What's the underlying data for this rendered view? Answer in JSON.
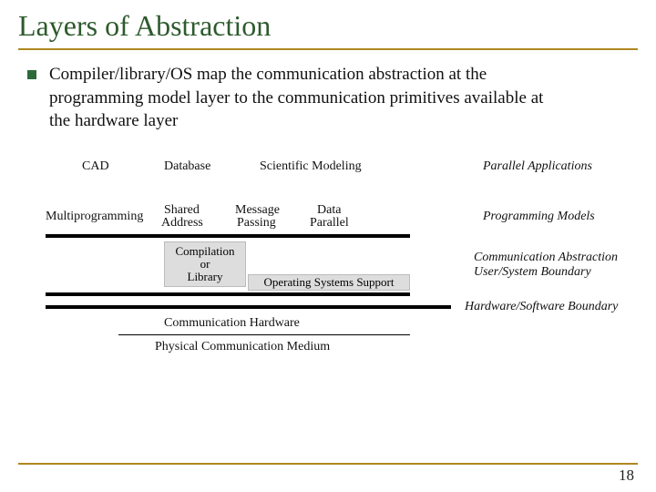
{
  "title": "Layers of Abstraction",
  "bullet": "Compiler/library/OS map the communication abstraction at the programming model layer to the communication primitives available at the hardware layer",
  "side": {
    "apps": "Parallel Applications",
    "models": "Programming Models",
    "comm_abs1": "Communication Abstraction",
    "comm_abs2": "User/System Boundary",
    "hw_sw": "Hardware/Software Boundary"
  },
  "apps": {
    "cad": "CAD",
    "db": "Database",
    "sci": "Scientific Modeling"
  },
  "models": {
    "multi": "Multiprogramming",
    "shared1": "Shared",
    "shared2": "Address",
    "msg1": "Message",
    "msg2": "Passing",
    "data1": "Data",
    "data2": "Parallel"
  },
  "boxes": {
    "compile": "Compilation\nor\nLibrary",
    "oss": "Operating Systems Support"
  },
  "hw": {
    "comm_hw": "Communication Hardware",
    "phys": "Physical Communication Medium"
  },
  "page": "18"
}
